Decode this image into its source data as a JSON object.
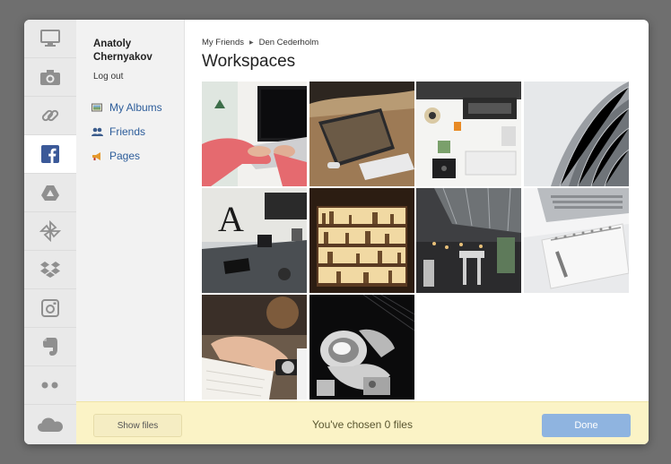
{
  "sidebar": {
    "services": [
      {
        "icon": "computer-icon"
      },
      {
        "icon": "camera-icon"
      },
      {
        "icon": "link-icon"
      },
      {
        "icon": "facebook-icon",
        "active": true
      },
      {
        "icon": "google-drive-icon"
      },
      {
        "icon": "pinwheel-icon"
      },
      {
        "icon": "dropbox-icon"
      },
      {
        "icon": "instagram-icon"
      },
      {
        "icon": "evernote-icon"
      },
      {
        "icon": "more-dots-icon"
      },
      {
        "icon": "cloud-icon"
      }
    ]
  },
  "account": {
    "name": "Anatoly Chernyakov",
    "logout": "Log out",
    "nav": [
      {
        "label": "My Albums",
        "icon": "albums-icon"
      },
      {
        "label": "Friends",
        "icon": "friends-icon"
      },
      {
        "label": "Pages",
        "icon": "pages-icon"
      }
    ]
  },
  "breadcrumb": {
    "parent": "My Friends",
    "current": "Den Cederholm"
  },
  "album_title": "Workspaces",
  "photos": [
    {
      "name": "laptop-typing-photo"
    },
    {
      "name": "desk-laptop-keyboard-photo"
    },
    {
      "name": "desk-topdown-photo"
    },
    {
      "name": "building-facade-photo"
    },
    {
      "name": "dark-desk-photo"
    },
    {
      "name": "bookshelf-photo"
    },
    {
      "name": "cafe-interior-photo"
    },
    {
      "name": "notebook-laptop-photo"
    },
    {
      "name": "writing-hand-photo"
    },
    {
      "name": "spacesuit-photo"
    }
  ],
  "footer": {
    "show_files": "Show files",
    "status": "You've chosen 0 files",
    "done": "Done"
  },
  "colors": {
    "accent": "#8fb4e0",
    "footer_bg": "#fbf3c6",
    "link": "#2d5d9a"
  }
}
